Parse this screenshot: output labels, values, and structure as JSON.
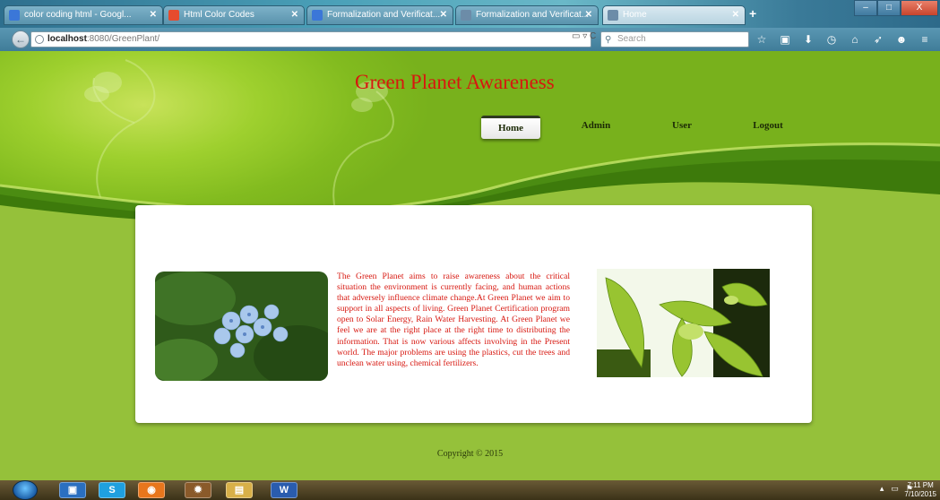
{
  "browser": {
    "tabs": [
      {
        "title": "color coding html - Googl...",
        "favicon_color": "#3b77d8"
      },
      {
        "title": "Html Color Codes",
        "favicon_color": "#e64b2d"
      },
      {
        "title": "Formalization and Verificat...",
        "favicon_color": "#3b77d8"
      },
      {
        "title": "Formalization and Verificat...",
        "favicon_color": "#6c8ca8"
      },
      {
        "title": "Home",
        "favicon_color": "#6c8ca8"
      }
    ],
    "tab_close": "✕",
    "new_tab": "+",
    "url_host": "localhost",
    "url_path": ":8080/GreenPlant/",
    "search_placeholder": "Search",
    "window_buttons": {
      "minimize": "–",
      "maximize": "□",
      "close": "X"
    }
  },
  "site": {
    "title": "Green Planet Awareness",
    "nav": [
      {
        "label": "Home",
        "active": true
      },
      {
        "label": "Admin",
        "active": false
      },
      {
        "label": "User",
        "active": false
      },
      {
        "label": "Logout",
        "active": false
      }
    ],
    "paragraph": "The Green Planet aims to raise awareness about the critical situation the environment is currently facing, and human actions that adversely influence climate change.At Green Planet we aim to support in all aspects of living. Green Planet Certification program open to Solar Energy, Rain Water Harvesting. At Green Planet we feel we are at the right place at the right time to distributing the information. That is now various affects involving in the Present world. The major problems are using the plastics, cut the trees and unclean water using, chemical fertilizers.",
    "copyright": "Copyright © 2015",
    "colors": {
      "accent_red": "#d7170f",
      "page_green": "#95c13a",
      "dark_green": "#3f7a0c"
    }
  },
  "taskbar": {
    "apps": [
      "outlook-icon",
      "skype-icon",
      "firefox-icon",
      "settings-icon",
      "explorer-icon",
      "word-icon"
    ],
    "time": "7:11 PM",
    "date": "7/10/2015"
  }
}
